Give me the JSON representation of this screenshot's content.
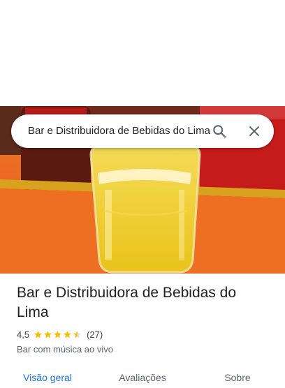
{
  "search": {
    "query": "Bar e Distribuidora de Bebidas do Lima"
  },
  "place": {
    "name": "Bar e Distribuidora de Bebidas do Lima",
    "rating_text": "4,5",
    "rating_value": 4.5,
    "rating_max": 5,
    "review_count": "(27)",
    "category": "Bar com música ao vivo"
  },
  "tabs": [
    {
      "label": "Visão geral",
      "active": true
    },
    {
      "label": "Avaliações",
      "active": false
    },
    {
      "label": "Sobre",
      "active": false
    }
  ],
  "colors": {
    "star": "#fbbc04",
    "accent": "#1a73e8"
  }
}
